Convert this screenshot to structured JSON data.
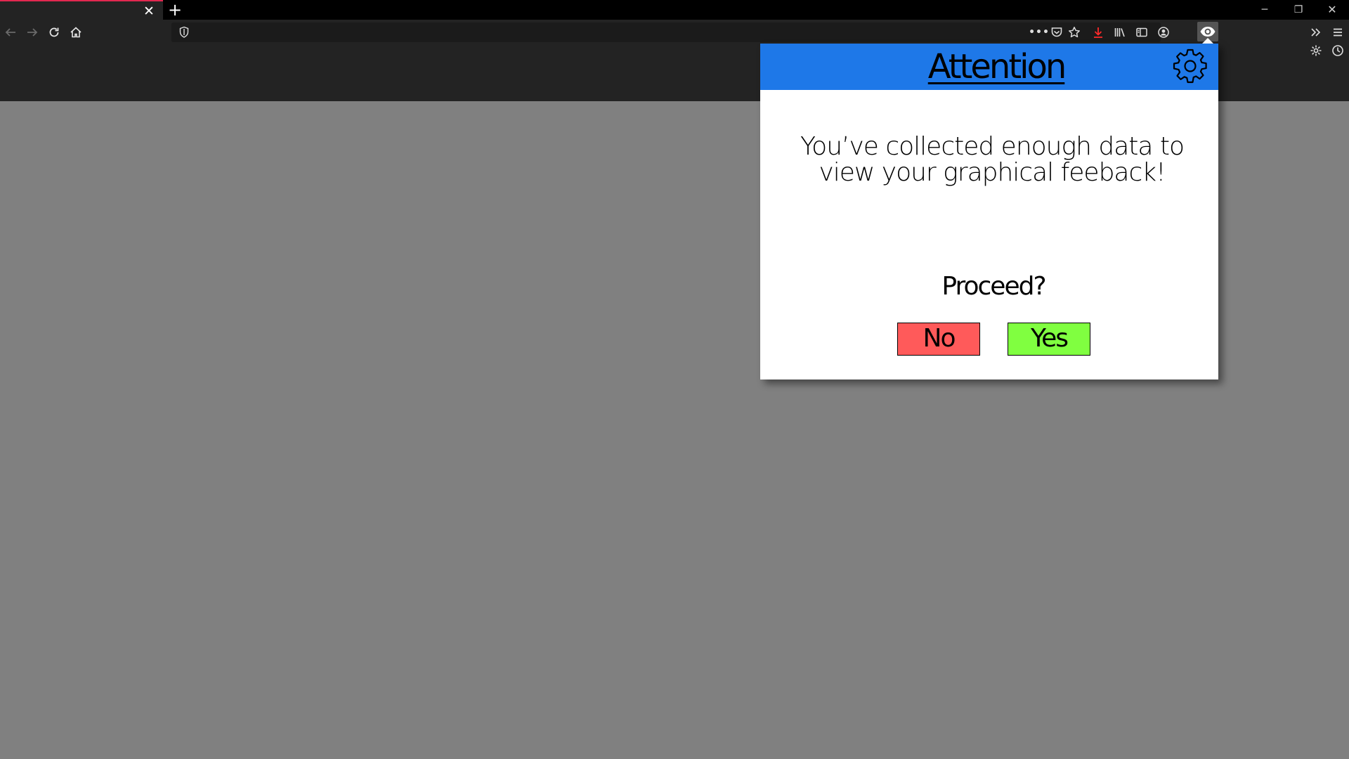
{
  "browser": {
    "tab": {
      "close_glyph": "✕"
    },
    "new_tab_glyph": "+",
    "window_controls": {
      "minimize": "─",
      "maximize": "❐",
      "close": "✕"
    },
    "url": {
      "value": ""
    },
    "toolbar_more": "•••",
    "accent_color": "#e22850",
    "download_color": "#ff2a2a",
    "icons": [
      "back-arrow-icon",
      "forward-arrow-icon",
      "reload-icon",
      "home-icon",
      "shield-icon",
      "pocket-icon",
      "star-icon",
      "download-icon",
      "library-icon",
      "sidebar-icon",
      "account-icon",
      "eye-extension-icon",
      "overflow-chevron-icon",
      "hamburger-menu-icon",
      "settings-icon",
      "clock-icon"
    ]
  },
  "popup": {
    "title": "Attention",
    "message": "You’ve collected enough data to view your graphical feeback!",
    "prompt": "Proceed?",
    "no_label": "No",
    "yes_label": "Yes",
    "header_color": "#1e78e8",
    "no_color": "#ff5a5a",
    "yes_color": "#80ff40"
  }
}
